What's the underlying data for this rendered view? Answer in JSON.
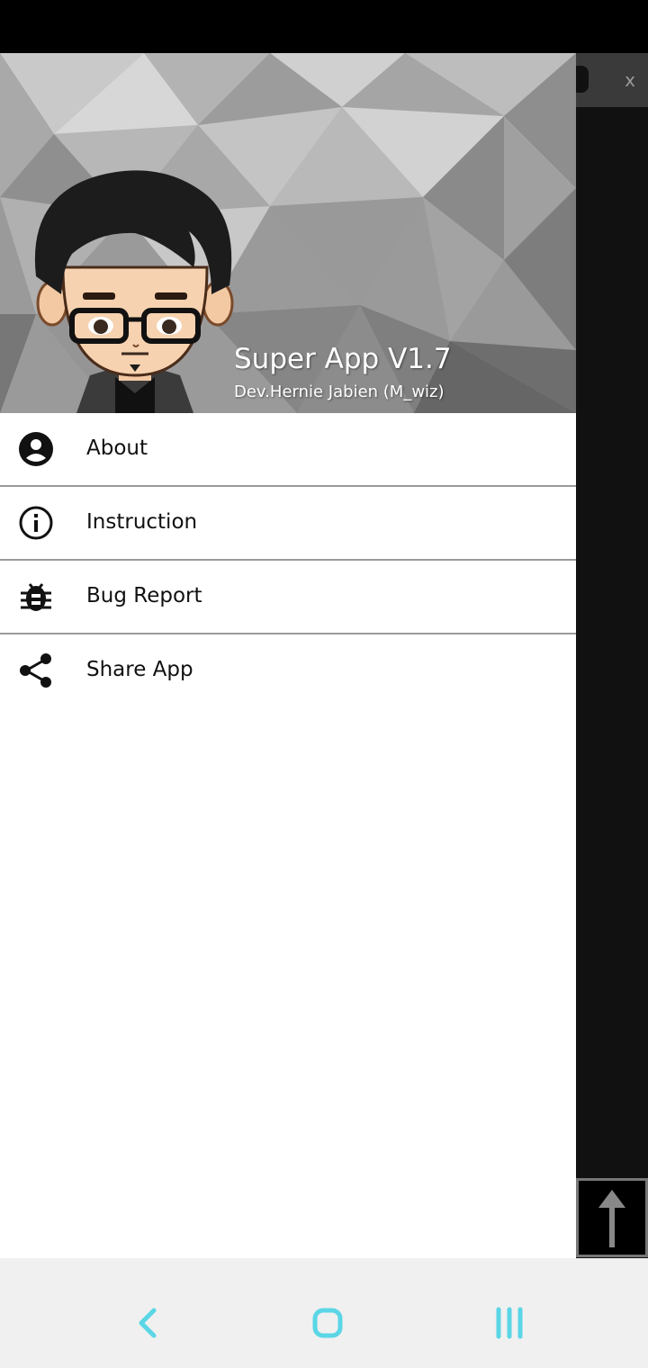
{
  "header": {
    "title": "Super App V1.7",
    "subtitle": "Dev.Hernie Jabien (M_wiz)"
  },
  "menu": {
    "items": [
      {
        "label": "About",
        "icon": "account-circle-icon"
      },
      {
        "label": "Instruction",
        "icon": "info-icon"
      },
      {
        "label": "Bug Report",
        "icon": "bug-icon"
      },
      {
        "label": "Share App",
        "icon": "share-icon"
      }
    ]
  },
  "behind": {
    "close_label": "x"
  },
  "colors": {
    "nav_accent": "#5ad6e6",
    "menu_divider": "#9a9a9a"
  }
}
